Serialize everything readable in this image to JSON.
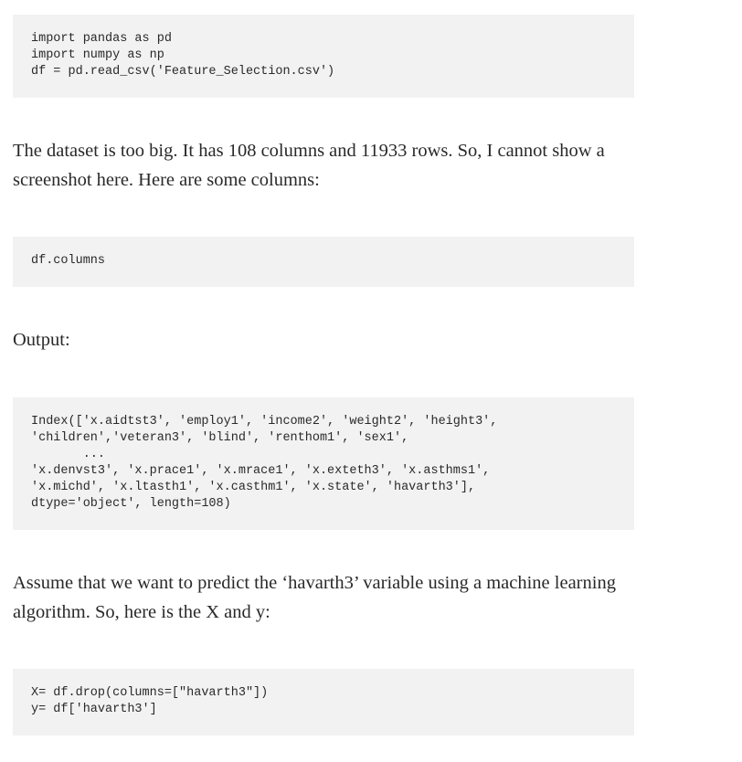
{
  "code_block_1": "import pandas as pd\nimport numpy as np\ndf = pd.read_csv('Feature_Selection.csv')",
  "paragraph_1": "The dataset is too big. It has 108 columns and 11933 rows. So, I cannot show a screenshot here. Here are some columns:",
  "code_block_2": "df.columns",
  "paragraph_2": "Output:",
  "code_block_3": "Index(['x.aidtst3', 'employ1', 'income2', 'weight2', 'height3',\n'children','veteran3', 'blind', 'renthom1', 'sex1',\n       ...\n'x.denvst3', 'x.prace1', 'x.mrace1', 'x.exteth3', 'x.asthms1',\n'x.michd', 'x.ltasth1', 'x.casthm1', 'x.state', 'havarth3'],\ndtype='object', length=108)",
  "paragraph_3": "Assume that we want to predict the ‘havarth3’ variable using a machine learning algorithm. So, here is the X and y:",
  "code_block_4": "X= df.drop(columns=[\"havarth3\"])\ny= df['havarth3']"
}
